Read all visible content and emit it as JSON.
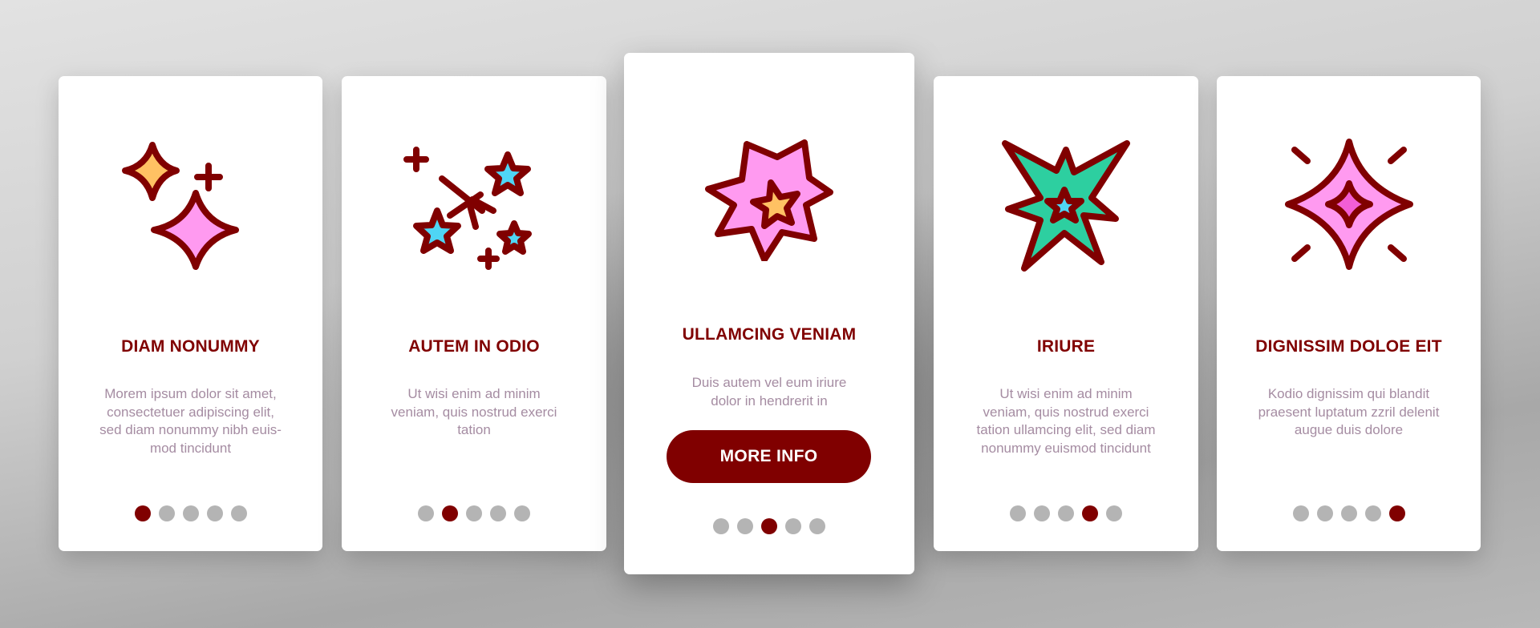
{
  "colors": {
    "accent": "#800000",
    "dot_inactive": "#b4b4b4",
    "description_text": "#a58ca2",
    "card_background": "#ffffff",
    "icon_orange": "#ffc163",
    "icon_pink": "#ff9af0",
    "icon_cyan": "#4fd5f5",
    "icon_teal": "#2dcfa0",
    "icon_magenta": "#f25ed5"
  },
  "cards": [
    {
      "icon": "sparkles-icon",
      "title": "DIAM NONUMMY",
      "description": "Morem ipsum dolor sit amet,\nconsectetuer adipiscing elit,\nsed diam nonummy nibh euis-\nmod tincidunt",
      "active_page": 1,
      "total_pages": 5
    },
    {
      "icon": "stars-and-firework-icon",
      "title": "AUTEM IN ODIO",
      "description": "Ut wisi enim ad minim\nveniam, quis nostrud exerci\ntation",
      "active_page": 2,
      "total_pages": 5
    },
    {
      "icon": "burst-star-icon",
      "title": "ULLAMCING VENIAM",
      "description": "Duis autem vel eum iriure\ndolor in hendrerit in",
      "button_label": "MORE INFO",
      "active_page": 3,
      "total_pages": 5
    },
    {
      "icon": "explosion-star-icon",
      "title": "IRIURE",
      "description": "Ut wisi enim ad minim\nveniam, quis nostrud exerci\ntation ullamcing elit, sed diam\nnonummy euismod tincidunt",
      "active_page": 4,
      "total_pages": 5
    },
    {
      "icon": "shine-sparkle-icon",
      "title": "DIGNISSIM DOLOE EIT",
      "description": "Kodio dignissim qui blandit\npraesent luptatum zzril delenit\naugue duis dolore",
      "active_page": 5,
      "total_pages": 5
    }
  ]
}
